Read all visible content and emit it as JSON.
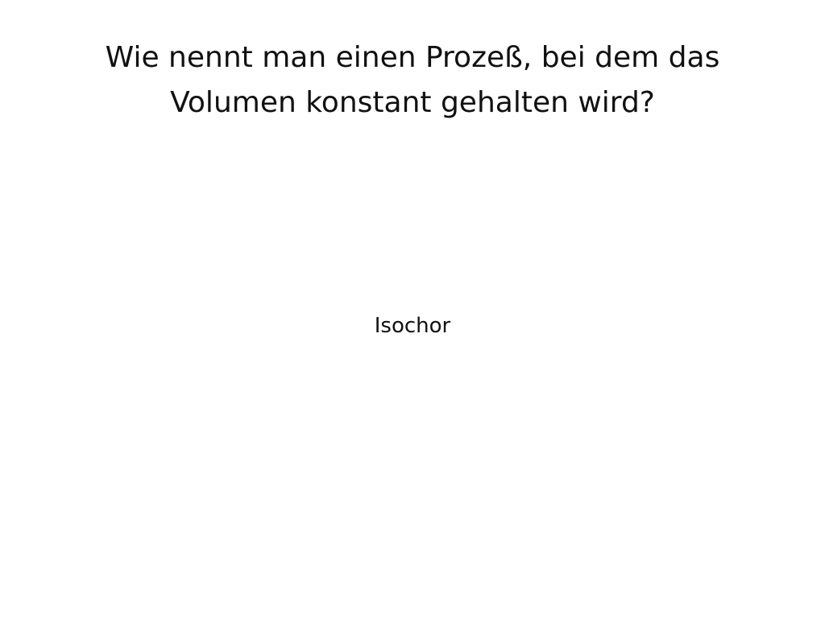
{
  "card": {
    "question_line_1": "Wie nennt man einen Prozeß, bei dem das",
    "question_line_2": "Volumen konstant gehalten wird?",
    "answer": "Isochor"
  }
}
